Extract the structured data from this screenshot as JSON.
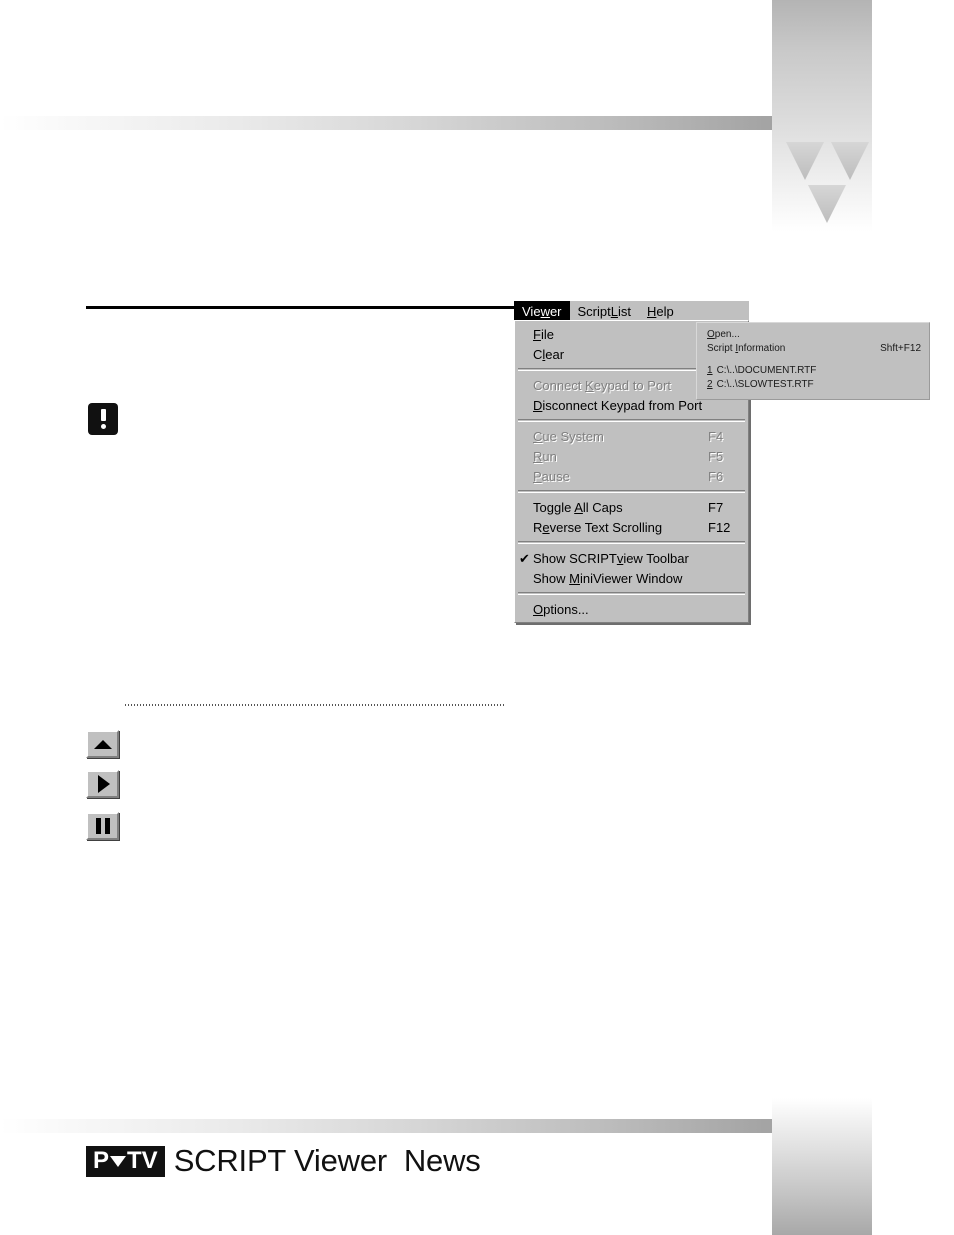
{
  "page": {
    "title": "SCRIPT Viewer News",
    "logo_badge_left": "P",
    "logo_badge_right": "TV",
    "logo_text": "SCRIPT Viewer  News"
  },
  "menubar": {
    "items": [
      {
        "label_pre": "Vie",
        "mnemonic": "w",
        "label_post": "er",
        "selected": true,
        "name": "menubar-item-viewer"
      },
      {
        "label_pre": "Script",
        "mnemonic": "L",
        "label_post": "ist",
        "selected": false,
        "name": "menubar-item-scriptlist"
      },
      {
        "label_pre": "",
        "mnemonic": "H",
        "label_post": "elp",
        "selected": false,
        "name": "menubar-item-help"
      }
    ]
  },
  "viewer_menu": {
    "groups": [
      {
        "items": [
          {
            "pre": "",
            "mnemonic": "F",
            "post": "ile",
            "accel": "",
            "disabled": false,
            "checked": false,
            "name": "menu-item-file"
          },
          {
            "pre": "C",
            "mnemonic": "l",
            "post": "ear",
            "accel": "",
            "disabled": false,
            "checked": false,
            "name": "menu-item-clear"
          }
        ]
      },
      {
        "items": [
          {
            "pre": "Connect ",
            "mnemonic": "K",
            "post": "eypad to Port",
            "accel": "",
            "disabled": true,
            "checked": false,
            "name": "menu-item-connect-keypad-to-port"
          },
          {
            "pre": "",
            "mnemonic": "D",
            "post": "isconnect Keypad from Port",
            "accel": "",
            "disabled": false,
            "checked": false,
            "name": "menu-item-disconnect-keypad-from-port"
          }
        ]
      },
      {
        "items": [
          {
            "pre": "",
            "mnemonic": "C",
            "post": "ue System",
            "accel": "F4",
            "disabled": true,
            "checked": false,
            "name": "menu-item-cue-system"
          },
          {
            "pre": "",
            "mnemonic": "R",
            "post": "un",
            "accel": "F5",
            "disabled": true,
            "checked": false,
            "name": "menu-item-run"
          },
          {
            "pre": "",
            "mnemonic": "P",
            "post": "ause",
            "accel": "F6",
            "disabled": true,
            "checked": false,
            "name": "menu-item-pause"
          }
        ]
      },
      {
        "items": [
          {
            "pre": "Toggle ",
            "mnemonic": "A",
            "post": "ll Caps",
            "accel": "F7",
            "disabled": false,
            "checked": false,
            "name": "menu-item-toggle-all-caps"
          },
          {
            "pre": "R",
            "mnemonic": "e",
            "post": "verse Text Scrolling",
            "accel": "F12",
            "disabled": false,
            "checked": false,
            "name": "menu-item-reverse-text-scrolling"
          }
        ]
      },
      {
        "items": [
          {
            "pre": "Show SCRIPT",
            "mnemonic": "v",
            "post": "iew Toolbar",
            "accel": "",
            "disabled": false,
            "checked": true,
            "name": "menu-item-show-scriptview-toolbar"
          },
          {
            "pre": "Show ",
            "mnemonic": "M",
            "post": "iniViewer Window",
            "accel": "",
            "disabled": false,
            "checked": false,
            "name": "menu-item-show-miniviewer-window"
          }
        ]
      },
      {
        "items": [
          {
            "pre": "",
            "mnemonic": "O",
            "post": "ptions...",
            "accel": "",
            "disabled": false,
            "checked": false,
            "name": "menu-item-options"
          }
        ]
      }
    ],
    "check_glyph": "✔"
  },
  "file_submenu": {
    "groups": [
      {
        "items": [
          {
            "num": "",
            "pre": "",
            "mnemonic": "O",
            "post": "pen...",
            "accel": "",
            "name": "submenu-item-open"
          },
          {
            "num": "",
            "pre": "Script ",
            "mnemonic": "I",
            "post": "nformation",
            "accel": "Shft+F12",
            "name": "submenu-item-script-information"
          }
        ]
      },
      {
        "items": [
          {
            "num": "1",
            "pre": "C:\\..\\DOCUMENT.RTF",
            "mnemonic": "",
            "post": "",
            "accel": "",
            "name": "submenu-item-recent-file-1"
          },
          {
            "num": "2",
            "pre": "C:\\..\\SLOWTEST.RTF",
            "mnemonic": "",
            "post": "",
            "accel": "",
            "name": "submenu-item-recent-file-2"
          }
        ]
      }
    ]
  },
  "toolbar": {
    "buttons": [
      {
        "icon": "triangle-up-icon",
        "name": "toolbar-button-cue"
      },
      {
        "icon": "triangle-right-icon",
        "name": "toolbar-button-run"
      },
      {
        "icon": "pause-icon",
        "name": "toolbar-button-pause"
      }
    ]
  },
  "note": {
    "icon": "exclamation-icon"
  },
  "colors": {
    "menu_face": "#c0c0c0",
    "menu_highlight": "#000000",
    "menu_disabled_text": "#808080",
    "rule": "#000000"
  }
}
